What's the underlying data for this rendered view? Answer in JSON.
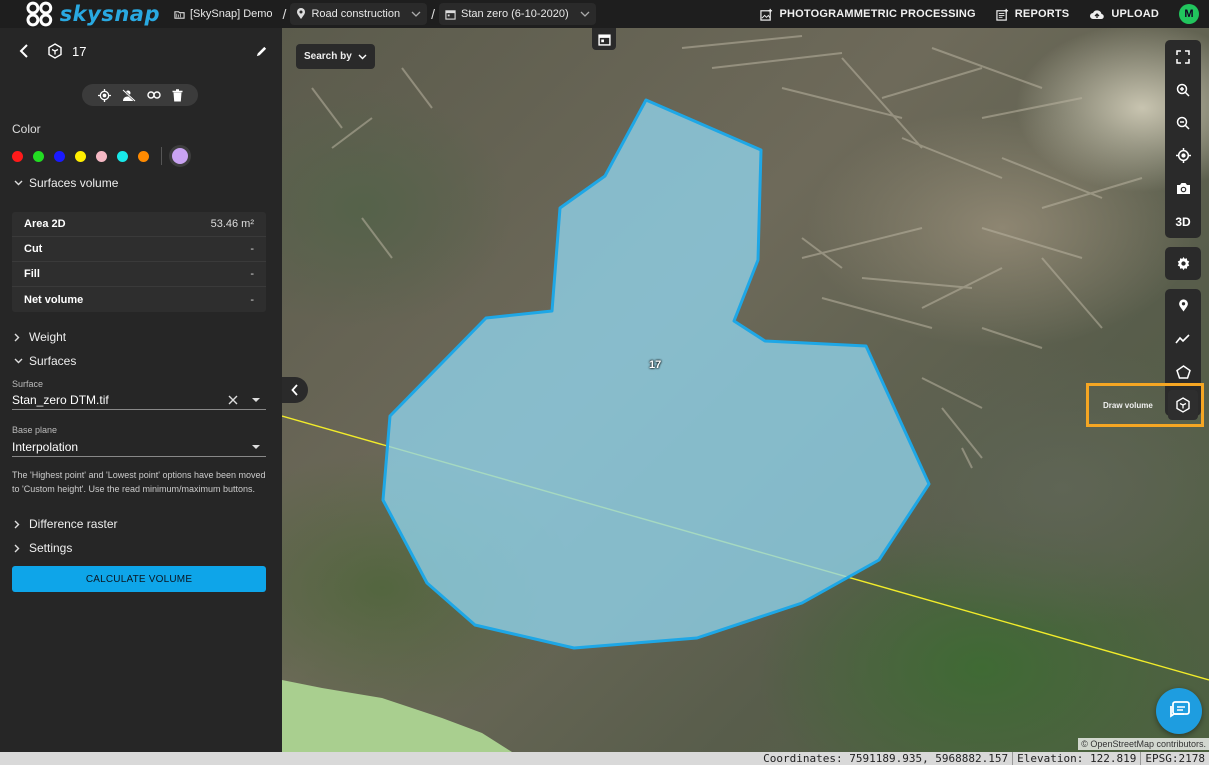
{
  "topbar": {
    "logo_text": "skysnap",
    "breadcrumbs": [
      {
        "label": "[SkySnap] Demo",
        "icon": "folder-icon"
      },
      {
        "label": "Road construction",
        "icon": "location-pin-icon"
      },
      {
        "label": "Stan zero (6-10-2020)",
        "icon": "calendar-icon"
      }
    ],
    "actions": [
      {
        "label": "PHOTOGRAMMETRIC PROCESSING",
        "icon": "image-add-icon"
      },
      {
        "label": "REPORTS",
        "icon": "report-icon"
      },
      {
        "label": "UPLOAD",
        "icon": "cloud-upload-icon"
      }
    ],
    "avatar_initial": "M",
    "avatar_color": "#21c55d"
  },
  "sidebar": {
    "title": "17",
    "color_label": "Color",
    "colors": [
      "#ff1a1a",
      "#22dd22",
      "#1a1aff",
      "#ffee00",
      "#f5b8c4",
      "#18e8e8",
      "#ff8a00"
    ],
    "selected_color": "#c9a3f2",
    "surfaces_volume_label": "Surfaces volume",
    "metrics": [
      {
        "key": "Area 2D",
        "value": "53.46 m²"
      },
      {
        "key": "Cut",
        "value": "-"
      },
      {
        "key": "Fill",
        "value": "-"
      },
      {
        "key": "Net volume",
        "value": "-"
      }
    ],
    "weight_label": "Weight",
    "surfaces_label": "Surfaces",
    "surface_field_label": "Surface",
    "surface_value": "Stan_zero DTM.tif",
    "base_plane_label": "Base plane",
    "base_plane_value": "Interpolation",
    "note": "The 'Highest point' and 'Lowest point' options have been moved to 'Custom height'. Use the read minimum/maximum buttons.",
    "difference_raster_label": "Difference raster",
    "settings_label": "Settings",
    "calculate_label": "CALCULATE VOLUME"
  },
  "map": {
    "search_label": "Search by",
    "polygon_label": "17",
    "polygon_fill": "#8fd3ec",
    "polygon_stroke": "#1ea7e6",
    "line_color": "#f2ec2a",
    "tools_group1": [
      "fullscreen-icon",
      "zoom-in-icon",
      "zoom-out-icon",
      "locate-icon",
      "camera-icon",
      "3D"
    ],
    "tools_group2": [
      "settings-icon"
    ],
    "tools_group3": [
      "marker-icon",
      "polyline-icon",
      "polygon-icon"
    ],
    "draw_volume_label": "Draw volume",
    "attribution": "© OpenStreetMap contributors."
  },
  "status": {
    "coordinates": "Coordinates: 7591189.935, 5968882.157",
    "elevation": "Elevation: 122.819",
    "epsg": "EPSG:2178"
  }
}
